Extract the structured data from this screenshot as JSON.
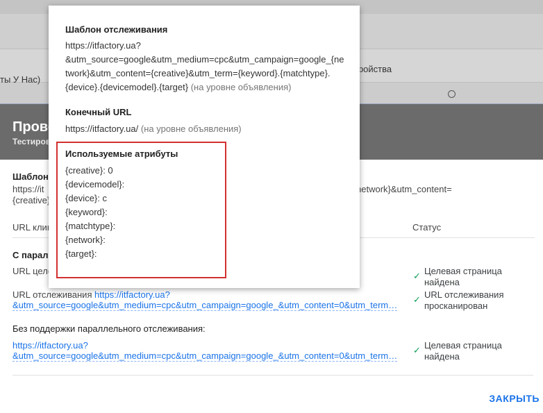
{
  "background": {
    "frag_left": "ты У Нас)",
    "frag_right": "тройства"
  },
  "dialog": {
    "title": "Прове",
    "subtitle": "Тестиров",
    "template_label": "Шаблон",
    "template_line1_left": "https://it",
    "template_line1_right": "network}&utm_content=",
    "template_line2_left": "{creative}",
    "col_url": "URL клик",
    "col_status": "Статус",
    "parallel_heading": "С парал",
    "parallel_url_label": "URL целе",
    "tracking_url_label": "URL отслеживания",
    "tracking_url_link_line1": "https://itfactory.ua?",
    "tracking_url_link_line2": "&utm_source=google&utm_medium=cpc&utm_campaign=google_&utm_content=0&utm_term…",
    "no_parallel_heading": "Без поддержки параллельного отслеживания:",
    "no_parallel_link_line1": "https://itfactory.ua?",
    "no_parallel_link_line2": "&utm_source=google&utm_medium=cpc&utm_campaign=google_&utm_content=0&utm_term…",
    "status1_line1": "Целевая страница",
    "status1_line2": "найдена",
    "status2_line1": "URL отслеживания",
    "status2_line2": "просканирован",
    "status3_line1": "Целевая страница",
    "status3_line2": "найдена",
    "close_label": "ЗАКРЫТЬ"
  },
  "popover": {
    "template_heading": "Шаблон отслеживания",
    "template_line1": "https://itfactory.ua?",
    "template_line2": "&utm_source=google&utm_medium=cpc&utm_campaign=google_{ne",
    "template_line3": "twork}&utm_content={creative}&utm_term={keyword}.{matchtype}.",
    "template_line4": "{device}.{devicemodel}.{target}",
    "template_level": "(на уровне объявления)",
    "final_url_heading": "Конечный URL",
    "final_url_value": "https://itfactory.ua/",
    "final_url_level": "(на уровне объявления)",
    "attributes_heading": "Используемые атрибуты",
    "attributes": [
      "{creative}: 0",
      "{devicemodel}:",
      "{device}: c",
      "{keyword}:",
      "{matchtype}:",
      "{network}:",
      "{target}:"
    ]
  },
  "colors": {
    "link": "#1a73e8",
    "check": "#0f9d58",
    "highlight_border": "#d32f2f",
    "header_bg": "#6b6b6b"
  },
  "icons": {
    "status_check": "checkmark-icon",
    "radio": "radio-button-icon"
  }
}
